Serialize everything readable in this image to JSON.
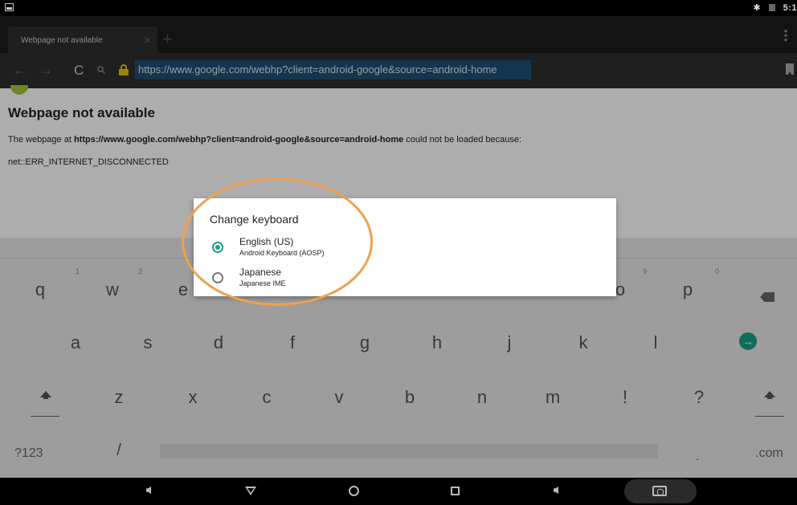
{
  "status_bar": {
    "clock": "5:1"
  },
  "browser": {
    "tab_title": "Webpage not available",
    "tab_close": "×",
    "new_tab": "+",
    "url": "https://www.google.com/webhp?client=android-google&source=android-home"
  },
  "page": {
    "title": "Webpage not available",
    "body_prefix": "The webpage at ",
    "body_url": "https://www.google.com/webhp?client=android-google&source=android-home",
    "body_suffix": " could not be loaded because:",
    "error_code": "net::ERR_INTERNET_DISCONNECTED"
  },
  "dialog": {
    "title": "Change keyboard",
    "options": [
      {
        "label": "English (US)",
        "subtitle": "Android Keyboard (AOSP)",
        "selected": true
      },
      {
        "label": "Japanese",
        "subtitle": "Japanese IME",
        "selected": false
      }
    ]
  },
  "keyboard": {
    "row1": [
      "q",
      "w",
      "e",
      "o",
      "p"
    ],
    "row1_hints": [
      "1",
      "2",
      "9",
      "0"
    ],
    "row2": [
      "a",
      "s",
      "d",
      "f",
      "g",
      "h",
      "j",
      "k",
      "l"
    ],
    "row3": [
      "z",
      "x",
      "c",
      "v",
      "b",
      "n",
      "m",
      "!",
      "?"
    ],
    "symbols_key": "?123",
    "slash_key": "/",
    "dot_key": ".",
    "dotcom_key": ".com",
    "enter_glyph": "→"
  },
  "colors": {
    "accent": "#1aa186",
    "annotation": "#f0a050",
    "url_highlight": "#1c4f73"
  }
}
